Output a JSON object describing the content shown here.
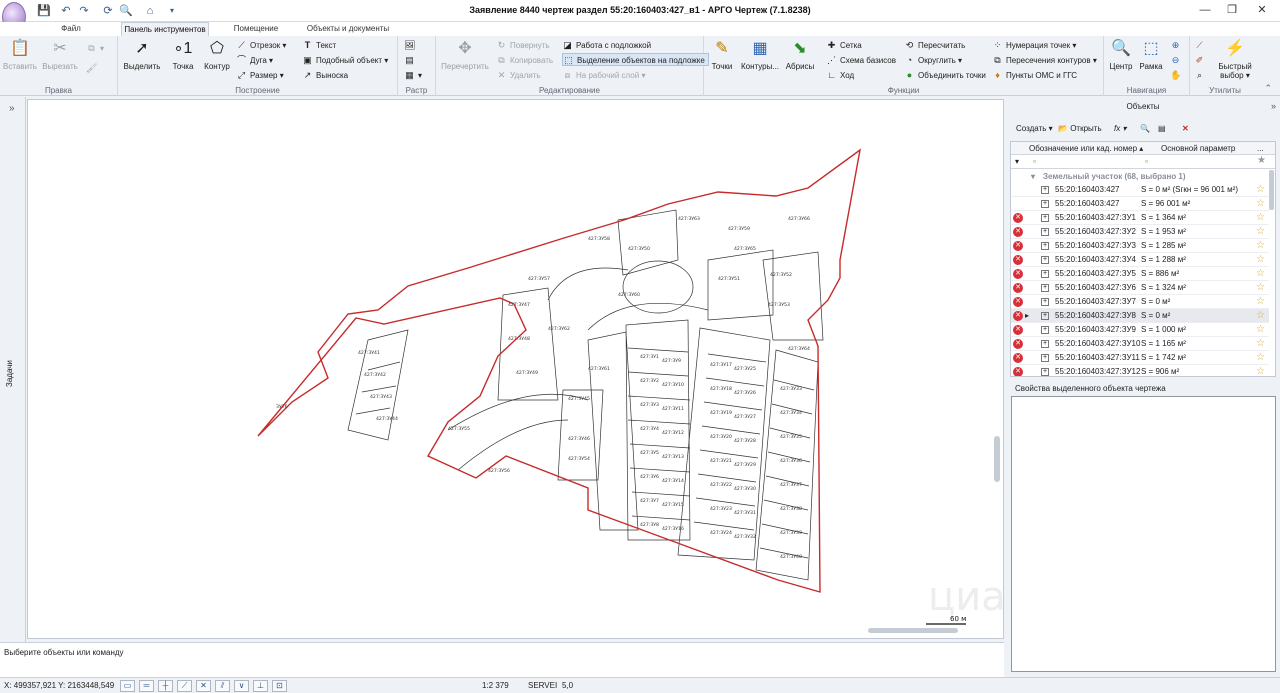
{
  "window": {
    "title": "Заявление 8440 чертеж раздел 55:20:160403:427_в1 - АРГО Чертеж (7.1.8238)"
  },
  "tabs": [
    "Файл",
    "Панель инструментов",
    "Помещение",
    "Объекты и документы"
  ],
  "ribbon": {
    "pravka": {
      "label": "Правка",
      "paste": "Вставить",
      "cut": "Вырезать"
    },
    "postroenie": {
      "label": "Построение",
      "select": "Выделить",
      "point": "Точка",
      "contour": "Контур",
      "segment": "Отрезок",
      "arc": "Дуга",
      "size": "Размер",
      "text": "Текст",
      "similar": "Подобный объект",
      "callout": "Выноска"
    },
    "raster": {
      "label": "Растр"
    },
    "editing": {
      "label": "Редактирование",
      "recompute": "Перечертить",
      "rotate": "Повернуть",
      "copy": "Копировать",
      "delete": "Удалить",
      "underlay": "Работа с подложкой",
      "select_underlay": "Выделение объектов на подложке",
      "to_layer": "На рабочий слой"
    },
    "functions": {
      "label": "Функции",
      "points": "Точки",
      "contours": "Контуры...",
      "abris": "Абрисы",
      "grid": "Сетка",
      "bases": "Схема базисов",
      "move": "Ход",
      "recalc": "Пересчитать",
      "round": "Округлить",
      "merge_points": "Объединить точки",
      "numbering": "Нумерация точек",
      "intersections": "Пересечения контуров",
      "oms": "Пункты ОМС и ГГС"
    },
    "navigation": {
      "label": "Навигация",
      "center": "Центр",
      "frame": "Рамка"
    },
    "utilities": {
      "label": "Утилиты",
      "quick_select": "Быстрый выбор"
    }
  },
  "left_strip": {
    "label": "Задачи"
  },
  "objects_panel": {
    "title": "Объекты",
    "create": "Создать",
    "open": "Открыть",
    "fx": "fx",
    "col_id": "Обозначение или кад. номер",
    "col_param": "Основной параметр",
    "more": "...",
    "group": "Земельный участок (68, выбрано 1)",
    "rows": [
      {
        "id": "55:20:160403:427",
        "param": "S = 0 м² (Sгкн = 96 001 м²)",
        "err": false,
        "selected": false
      },
      {
        "id": "55:20:160403:427",
        "param": "S = 96 001 м²",
        "err": false,
        "selected": false
      },
      {
        "id": "55:20:160403:427:ЗУ1",
        "param": "S = 1 364 м²",
        "err": true,
        "selected": false
      },
      {
        "id": "55:20:160403:427:ЗУ2",
        "param": "S = 1 953 м²",
        "err": true,
        "selected": false
      },
      {
        "id": "55:20:160403:427:ЗУ3",
        "param": "S = 1 285 м²",
        "err": true,
        "selected": false
      },
      {
        "id": "55:20:160403:427:ЗУ4",
        "param": "S = 1 288 м²",
        "err": true,
        "selected": false
      },
      {
        "id": "55:20:160403:427:ЗУ5",
        "param": "S = 886 м²",
        "err": true,
        "selected": false
      },
      {
        "id": "55:20:160403:427:ЗУ6",
        "param": "S = 1 324 м²",
        "err": true,
        "selected": false
      },
      {
        "id": "55:20:160403:427:ЗУ7",
        "param": "S = 0 м²",
        "err": true,
        "selected": false
      },
      {
        "id": "55:20:160403:427:ЗУ8",
        "param": "S = 0 м²",
        "err": true,
        "selected": true
      },
      {
        "id": "55:20:160403:427:ЗУ9",
        "param": "S = 1 000 м²",
        "err": true,
        "selected": false
      },
      {
        "id": "55:20:160403:427:ЗУ10",
        "param": "S = 1 165 м²",
        "err": true,
        "selected": false
      },
      {
        "id": "55:20:160403:427:ЗУ11",
        "param": "S = 1 742 м²",
        "err": true,
        "selected": false
      },
      {
        "id": "55:20:160403:427:ЗУ12",
        "param": "S = 906 м²",
        "err": true,
        "selected": false
      }
    ],
    "props_title": "Свойства выделенного объекта чертежа"
  },
  "drawing": {
    "scale_bar": "60 м",
    "plot_labels": [
      "427:ЗУ1",
      "427:ЗУ2",
      "427:ЗУ3",
      "427:ЗУ4",
      "427:ЗУ5",
      "427:ЗУ6",
      "427:ЗУ7",
      "427:ЗУ8",
      "427:ЗУ9",
      "427:ЗУ10",
      "427:ЗУ11",
      "427:ЗУ12",
      "427:ЗУ13",
      "427:ЗУ14",
      "427:ЗУ15",
      "427:ЗУ16",
      "427:ЗУ17",
      "427:ЗУ18",
      "427:ЗУ19",
      "427:ЗУ20",
      "427:ЗУ21",
      "427:ЗУ22",
      "427:ЗУ23",
      "427:ЗУ24",
      "427:ЗУ25",
      "427:ЗУ26",
      "427:ЗУ27",
      "427:ЗУ28",
      "427:ЗУ29",
      "427:ЗУ30",
      "427:ЗУ31",
      "427:ЗУ32",
      "427:ЗУ33",
      "427:ЗУ34",
      "427:ЗУ35",
      "427:ЗУ36",
      "427:ЗУ37",
      "427:ЗУ38",
      "427:ЗУ39",
      "427:ЗУ40",
      "427:ЗУ41",
      "427:ЗУ42",
      "427:ЗУ43",
      "427:ЗУ44",
      "427:ЗУ45",
      "427:ЗУ46",
      "427:ЗУ47",
      "427:ЗУ48",
      "427:ЗУ49",
      "427:ЗУ50",
      "427:ЗУ51",
      "427:ЗУ52",
      "427:ЗУ53",
      "427:ЗУ54",
      "427:ЗУ55",
      "427:ЗУ56",
      "427:ЗУ57",
      "427:ЗУ58",
      "427:ЗУ59",
      "427:ЗУ60",
      "427:ЗУ61",
      "427:ЗУ62",
      "427:ЗУ63",
      "427:ЗУ64",
      "427:ЗУ65",
      "427:ЗУ66"
    ],
    "extra_label": "ЗУ76"
  },
  "command_line": {
    "prompt": "Выберите объекты или команду"
  },
  "status": {
    "coords": "X: 499357,921 Y: 2163448,549",
    "scale": "1:2 379",
    "server": "SERVEI",
    "value": "5,0"
  },
  "watermark": "циан"
}
